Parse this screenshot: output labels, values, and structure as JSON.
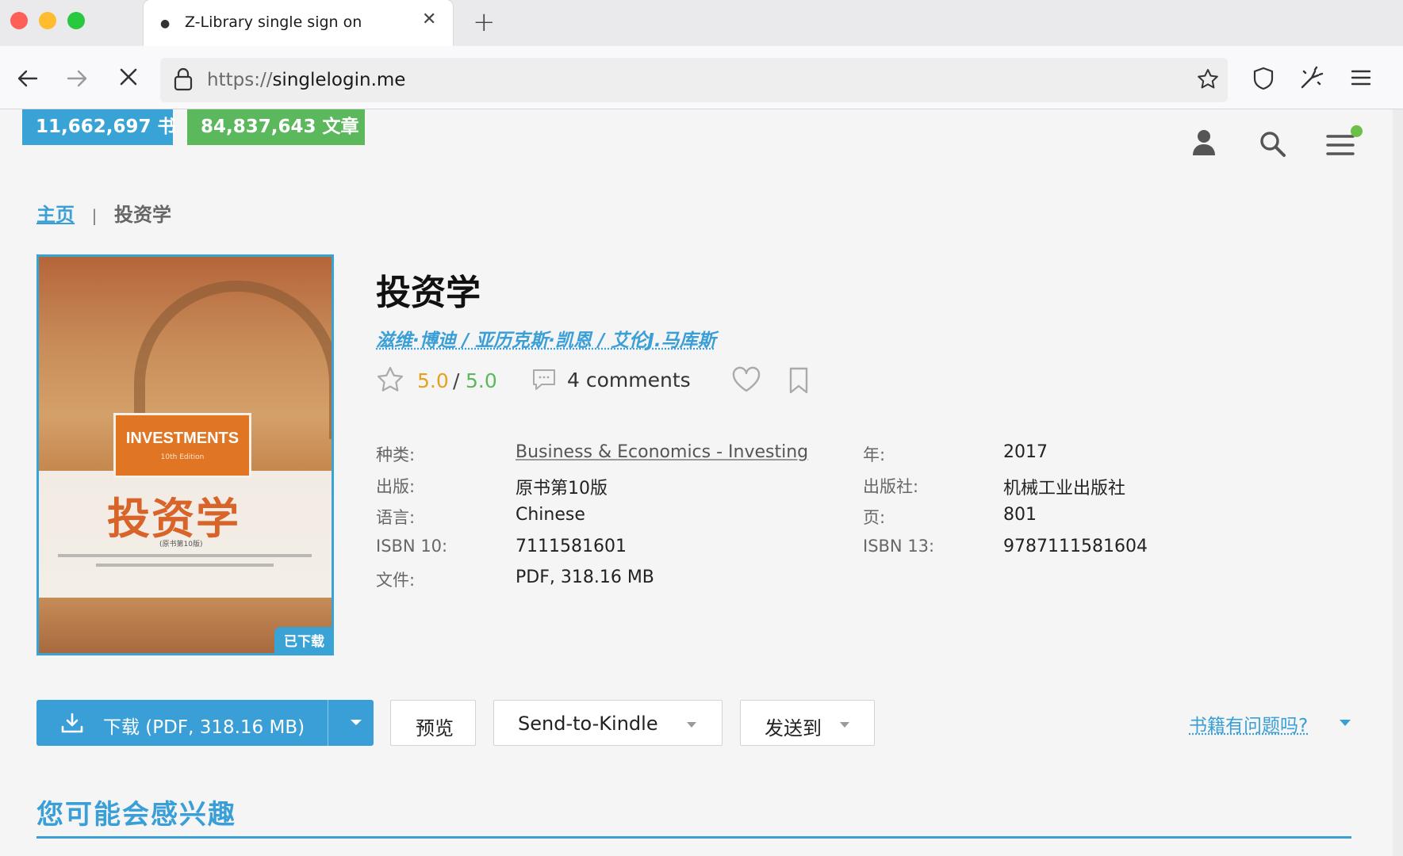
{
  "browser": {
    "tab_title": "Z-Library single sign on",
    "url_scheme": "https://",
    "url_host": "singlelogin.me"
  },
  "stats": {
    "books": "11,662,697 书",
    "articles": "84,837,643 文章"
  },
  "breadcrumb": {
    "home": "主页",
    "separator": "|",
    "current": "投资学"
  },
  "cover": {
    "english_title": "INVESTMENTS",
    "edition_en": "10th Edition",
    "chinese_title": "投资学",
    "edition_cn": "(原书第10版)",
    "badge": "已下载"
  },
  "book": {
    "title": "投资学",
    "authors": "滋维·博迪 / 亚历克斯·凯恩 / 艾伦J.马库斯",
    "rating": "5.0",
    "rating_sep": "/",
    "rating_max": "5.0",
    "comments": "4 comments"
  },
  "properties": {
    "category_label": "种类:",
    "category_value": "Business & Economics - Investing",
    "year_label": "年:",
    "year_value": "2017",
    "edition_label": "出版:",
    "edition_value": "原书第10版",
    "publisher_label": "出版社:",
    "publisher_value": "机械工业出版社",
    "language_label": "语言:",
    "language_value": "Chinese",
    "pages_label": "页:",
    "pages_value": "801",
    "isbn10_label": "ISBN 10:",
    "isbn10_value": "7111581601",
    "isbn13_label": "ISBN 13:",
    "isbn13_value": "9787111581604",
    "file_label": "文件:",
    "file_value": "PDF, 318.16 MB"
  },
  "actions": {
    "download": "下载 (PDF, 318.16 MB)",
    "preview": "预览",
    "send_to_kindle": "Send-to-Kindle",
    "send_to": "发送到",
    "report_issue": "书籍有问题吗?"
  },
  "section": {
    "heading": "您可能会感兴趣"
  },
  "colors": {
    "accent_blue": "#3a9fd6",
    "stat_green": "#5cb85c",
    "rating_orange": "#e7a11d"
  }
}
